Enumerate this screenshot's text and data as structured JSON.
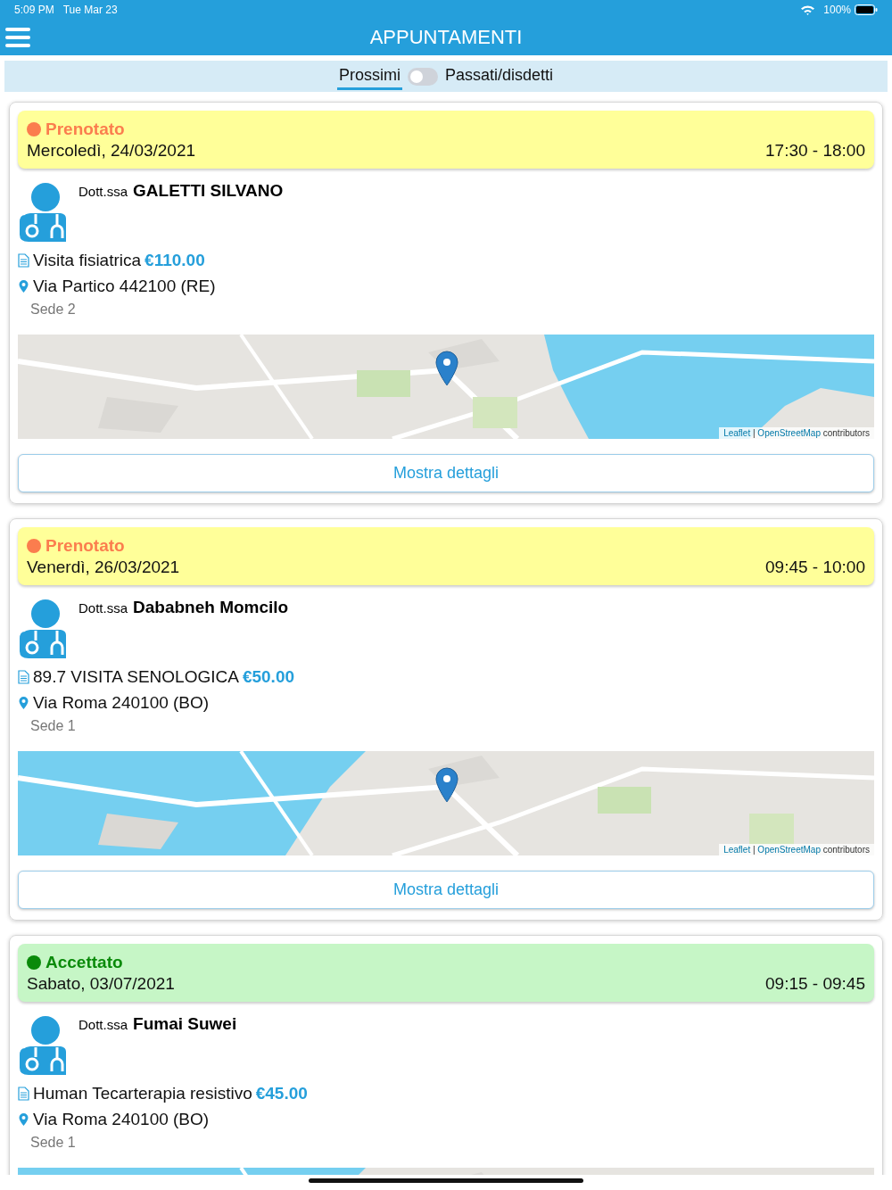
{
  "status_bar": {
    "time": "5:09 PM",
    "date": "Tue Mar 23",
    "battery": "100%"
  },
  "header": {
    "title": "APPUNTAMENTI"
  },
  "segment": {
    "options": [
      {
        "label": "Prossimi",
        "selected": true
      },
      {
        "label": "Passati/disdetti",
        "selected": false
      }
    ],
    "toggle_on": false
  },
  "appointments": [
    {
      "status": {
        "kind": "booked",
        "label": "Prenotato",
        "color": "#fb7d4e"
      },
      "date": "Mercoledì, 24/03/2021",
      "time": "17:30 - 18:00",
      "doctor_title": "Dott.ssa",
      "doctor_name": "GALETTI SILVANO",
      "service": "Visita fisiatrica",
      "price": "€110.00",
      "address": "Via Partico 442100 (RE)",
      "location": "Sede 2",
      "map": {
        "kind": "picture",
        "attribution": {
          "link_1": "Leaflet",
          "separator": "|",
          "link_2": "OpenStreetMap",
          "text": "contributors"
        }
      },
      "button": "Mostra dettagli"
    },
    {
      "status": {
        "kind": "booked",
        "label": "Prenotato",
        "color": "#fb7d4e"
      },
      "date": "Venerdì, 26/03/2021",
      "time": "09:45 - 10:00",
      "doctor_title": "Dott.ssa",
      "doctor_name": "Dababneh Momcilo",
      "service": "89.7 VISITA SENOLOGICA",
      "price": "€50.00",
      "address": "Via Roma 240100 (BO)",
      "location": "Sede 1",
      "map": {
        "kind": "picture",
        "attribution": {
          "link_1": "Leaflet",
          "separator": "|",
          "link_2": "OpenStreetMap",
          "text": "contributors"
        }
      },
      "button": "Mostra dettagli"
    },
    {
      "status": {
        "kind": "accepted",
        "label": "Accettato",
        "color": "#0a8a0a"
      },
      "date": "Sabato, 03/07/2021",
      "time": "09:15 - 09:45",
      "doctor_title": "Dott.ssa",
      "doctor_name": "Fumai Suwei",
      "service": "Human Tecarterapia resistivo",
      "price": "€45.00",
      "address": "Via Roma 240100 (BO)",
      "location": "Sede 1"
    }
  ]
}
